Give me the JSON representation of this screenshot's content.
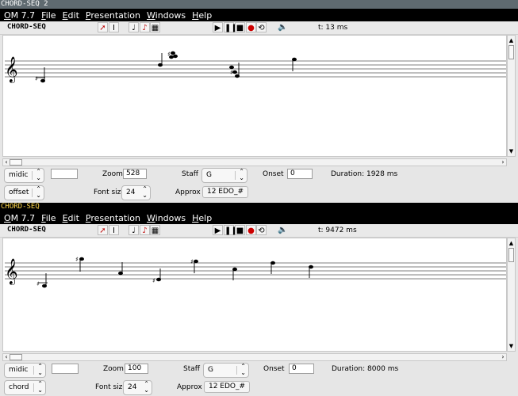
{
  "windows": [
    {
      "title": "CHORD-SEQ 2",
      "menu": [
        "OM 7.7",
        "File",
        "Edit",
        "Presentation",
        "Windows",
        "Help"
      ],
      "editor_title": "CHORD-SEQ",
      "time": "t: 13 ms",
      "controls": {
        "mode1": "midic",
        "mode2": "offset",
        "field1": "",
        "zoom_label": "Zoom",
        "zoom_value": "528",
        "fontsize_label": "Font size",
        "fontsize_value": "24",
        "staff_label": "Staff",
        "staff_value": "G",
        "approx_label": "Approx",
        "approx_value": "12 EDO_#",
        "onset_label": "Onset",
        "onset_value": "0",
        "duration": "Duration: 1928 ms"
      }
    },
    {
      "title": "CHORD-SEQ",
      "menu": [
        "OM 7.7",
        "File",
        "Edit",
        "Presentation",
        "Windows",
        "Help"
      ],
      "editor_title": "CHORD-SEQ",
      "time": "t: 9472 ms",
      "controls": {
        "mode1": "midic",
        "mode2": "chord",
        "field1": "",
        "zoom_label": "Zoom",
        "zoom_value": "100",
        "fontsize_label": "Font size",
        "fontsize_value": "24",
        "staff_label": "Staff",
        "staff_value": "G",
        "approx_label": "Approx",
        "approx_value": "12 EDO_#",
        "onset_label": "Onset",
        "onset_value": "0",
        "duration": "Duration: 8000 ms"
      }
    }
  ],
  "icons": {
    "select": "arrow-cursor-icon",
    "text": "text-cursor-icon",
    "note": "note-icon",
    "edit": "note-red-icon",
    "grid": "grid-icon",
    "play": "play-icon",
    "pause": "pause-icon",
    "stop": "stop-icon",
    "record": "record-icon",
    "loop": "loop-icon",
    "speaker": "speaker-icon",
    "clef": "treble-clef-icon",
    "up": "up-arrow-icon",
    "down": "down-arrow-icon",
    "left": "left-arrow-icon",
    "right": "right-arrow-icon",
    "sharp": "sharp-icon",
    "chevron": "chevron-updown-icon"
  },
  "colors": {
    "record": "#cc0000",
    "edit": "#c01010",
    "title_active": "#ffd84a"
  }
}
